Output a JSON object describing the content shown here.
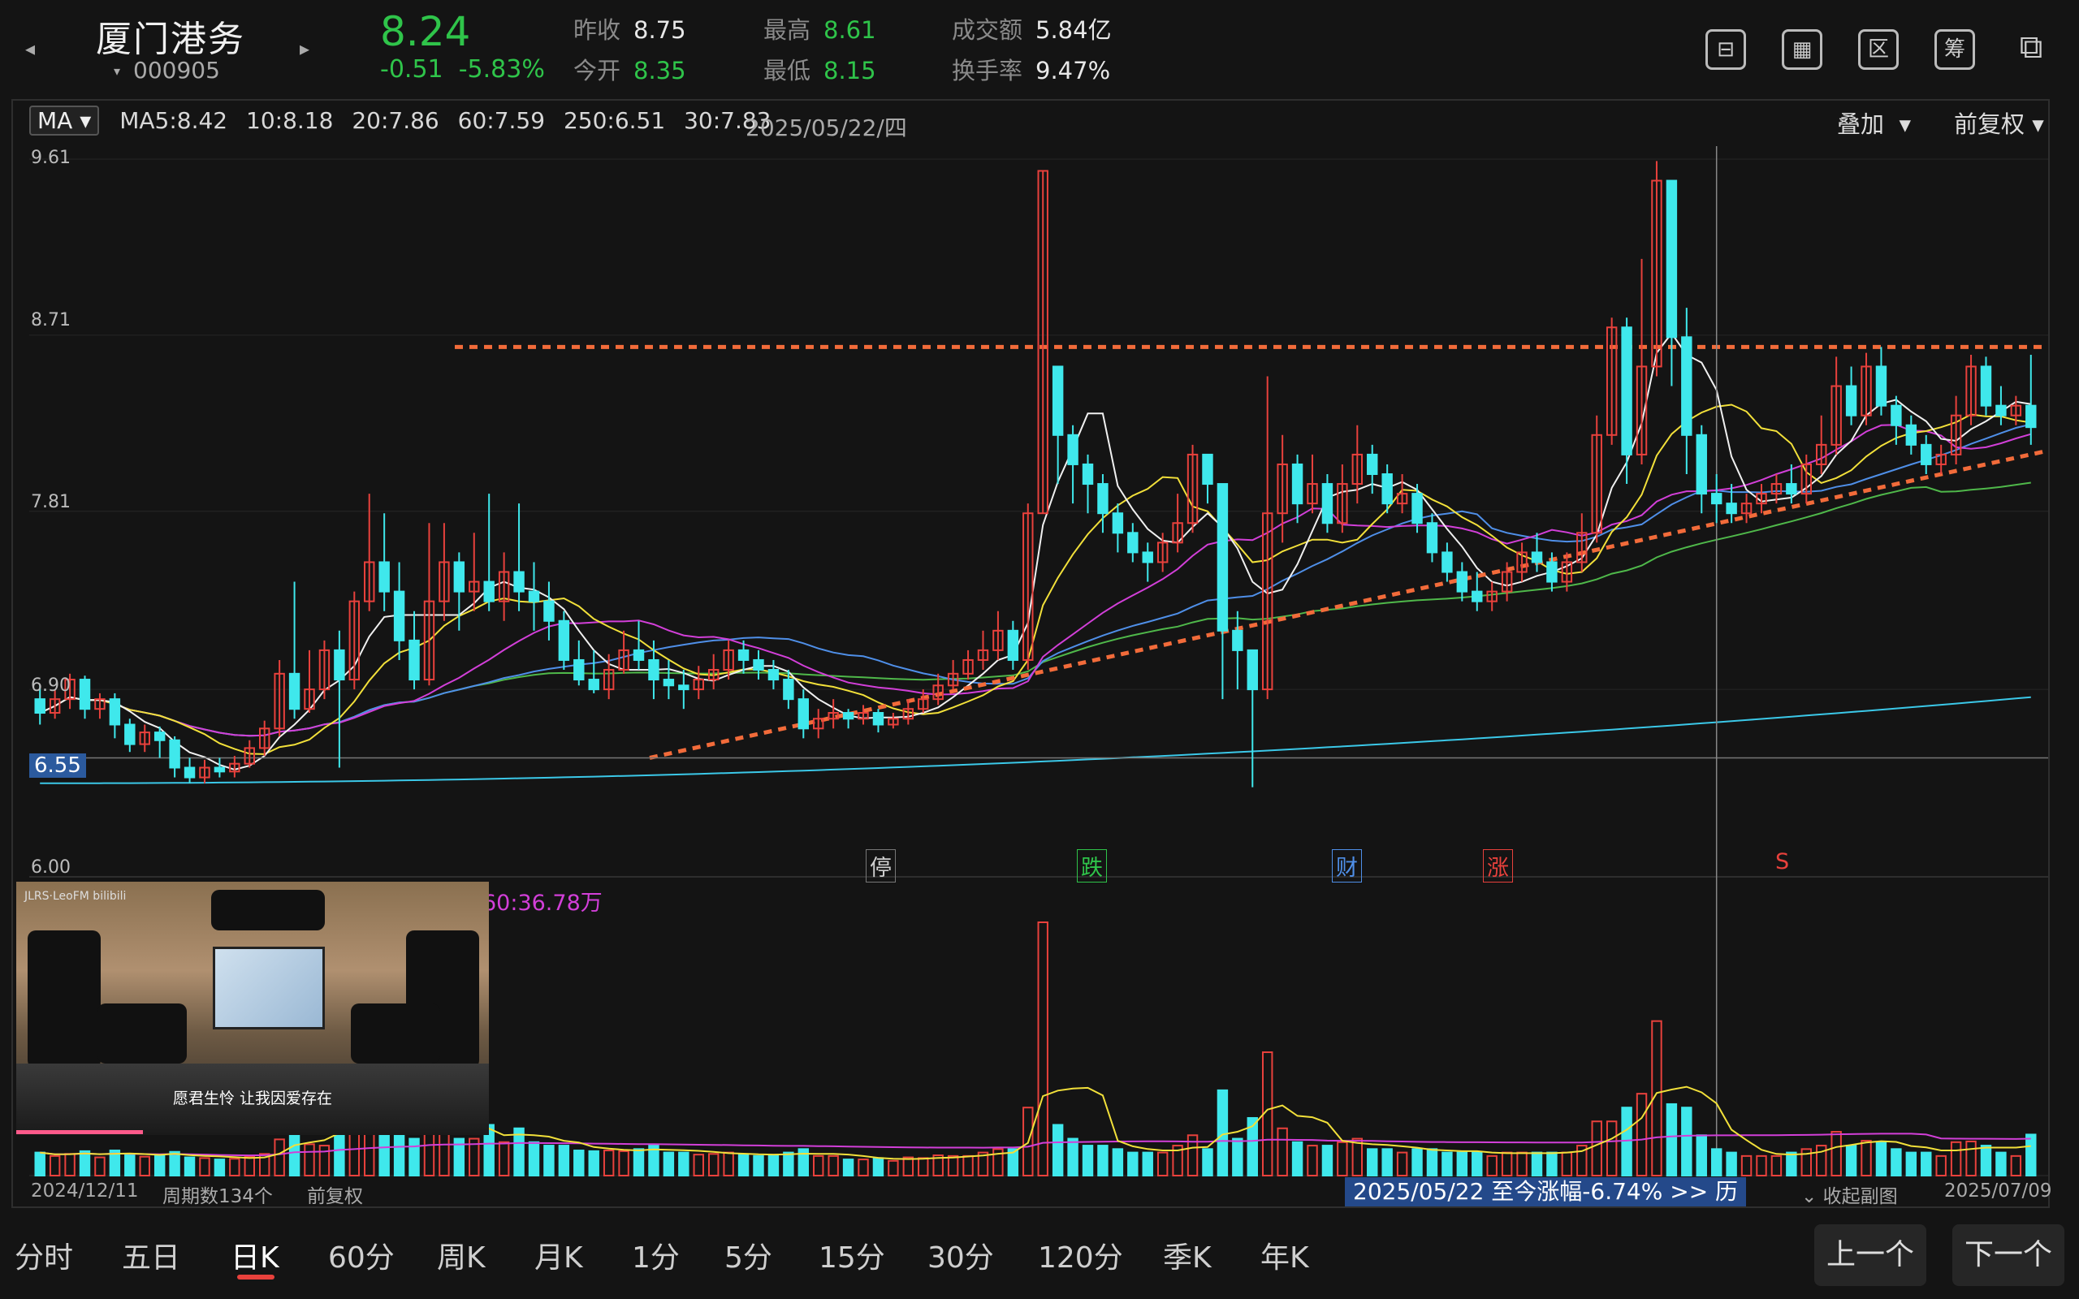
{
  "header": {
    "stock_name": "厦门港务",
    "stock_code": "000905",
    "price": "8.24",
    "change": "-0.51",
    "change_pct": "-5.83%",
    "stats": [
      {
        "label": "昨收",
        "value": "8.75",
        "color": "w"
      },
      {
        "label": "今开",
        "value": "8.35",
        "color": "g"
      },
      {
        "label": "最高",
        "value": "8.61",
        "color": "g"
      },
      {
        "label": "最低",
        "value": "8.15",
        "color": "g"
      },
      {
        "label": "成交额",
        "value": "5.84亿",
        "color": "w"
      },
      {
        "label": "换手率",
        "value": "9.47%",
        "color": "w"
      }
    ],
    "tools": [
      "⊟",
      "▦",
      "区",
      "筹",
      "⧉"
    ]
  },
  "ma_bar": {
    "button": "MA",
    "items": [
      {
        "text": "MA5:8.42",
        "color": "#f0f0f0"
      },
      {
        "text": "10:8.18",
        "color": "#f2e03a"
      },
      {
        "text": "20:7.86",
        "color": "#d23fd8"
      },
      {
        "text": "60:7.59",
        "color": "#4fb84a"
      },
      {
        "text": "250:6.51",
        "color": "#3bc8e8"
      },
      {
        "text": "30:7.83",
        "color": "#4f8fe8"
      }
    ],
    "date": "2025/05/22/四",
    "overlay": "叠加",
    "adjust": "前复权"
  },
  "y_axis": [
    "9.61",
    "8.71",
    "7.81",
    "6.90",
    "6.00"
  ],
  "price_tag": "6.55",
  "markers": [
    {
      "text": "停",
      "color": "#cfcfcf",
      "border": "#777"
    },
    {
      "text": "跌",
      "color": "#2fc44a",
      "border": "#2fc44a"
    },
    {
      "text": "财",
      "color": "#4f8fe8",
      "border": "#4f8fe8"
    },
    {
      "text": "涨",
      "color": "#e8413c",
      "border": "#e8413c"
    },
    {
      "text": "S",
      "color": "#e8413c",
      "border": "transparent"
    }
  ],
  "volume": {
    "ma_label": "60:36.78万"
  },
  "bottom": {
    "start_date": "2024/12/11",
    "period_count": "周期数134个",
    "adjust": "前复权",
    "range_info": "2025/05/22 至今涨幅-6.74%  >> 历",
    "collapse": "收起副图",
    "end_date": "2025/07/09"
  },
  "video": {
    "brand": "JLRS·LeoFM bilibili",
    "caption": "愿君生怜 让我因爱存在"
  },
  "tabs": [
    "分时",
    "五日",
    "日K",
    "60分",
    "周K",
    "月K",
    "1分",
    "5分",
    "15分",
    "30分",
    "120分",
    "季K",
    "年K"
  ],
  "active_tab": "日K",
  "nav": {
    "prev": "上一个",
    "next": "下一个"
  },
  "colors": {
    "up": "#e8413c",
    "down": "#3fe8ec",
    "ma5": "#f0f0f0",
    "ma10": "#f2e03a",
    "ma20": "#d23fd8",
    "ma60": "#4fb84a",
    "ma250": "#3bc8e8",
    "ma30": "#4f8fe8",
    "trendline": "#f26b3a"
  },
  "chart_data": {
    "type": "candlestick",
    "ylim": [
      6.0,
      9.61
    ],
    "date_range": [
      "2024/12/11",
      "2025/07/09"
    ],
    "periods": 134,
    "candles": [
      [
        6.85,
        6.78,
        6.92,
        6.72
      ],
      [
        6.78,
        6.85,
        6.9,
        6.75
      ],
      [
        6.85,
        6.95,
        6.98,
        6.8
      ],
      [
        6.95,
        6.8,
        6.97,
        6.75
      ],
      [
        6.8,
        6.85,
        6.88,
        6.75
      ],
      [
        6.85,
        6.72,
        6.88,
        6.65
      ],
      [
        6.72,
        6.62,
        6.75,
        6.58
      ],
      [
        6.62,
        6.68,
        6.72,
        6.58
      ],
      [
        6.68,
        6.64,
        6.71,
        6.55
      ],
      [
        6.64,
        6.5,
        6.66,
        6.45
      ],
      [
        6.5,
        6.45,
        6.55,
        6.42
      ],
      [
        6.45,
        6.5,
        6.54,
        6.42
      ],
      [
        6.5,
        6.48,
        6.55,
        6.45
      ],
      [
        6.48,
        6.52,
        6.56,
        6.45
      ],
      [
        6.52,
        6.6,
        6.64,
        6.5
      ],
      [
        6.6,
        6.7,
        6.74,
        6.56
      ],
      [
        6.7,
        6.98,
        7.05,
        6.66
      ],
      [
        6.98,
        6.8,
        7.45,
        6.75
      ],
      [
        6.8,
        6.9,
        7.1,
        6.78
      ],
      [
        6.9,
        7.1,
        7.15,
        6.85
      ],
      [
        7.1,
        6.95,
        7.2,
        6.5
      ],
      [
        6.95,
        7.35,
        7.4,
        6.9
      ],
      [
        7.35,
        7.55,
        7.9,
        7.3
      ],
      [
        7.55,
        7.4,
        7.8,
        7.3
      ],
      [
        7.4,
        7.15,
        7.55,
        7.05
      ],
      [
        7.15,
        6.95,
        7.3,
        6.9
      ],
      [
        6.95,
        7.35,
        7.75,
        6.92
      ],
      [
        7.35,
        7.55,
        7.75,
        7.25
      ],
      [
        7.55,
        7.4,
        7.6,
        7.2
      ],
      [
        7.4,
        7.45,
        7.7,
        7.3
      ],
      [
        7.45,
        7.35,
        7.9,
        7.3
      ],
      [
        7.35,
        7.5,
        7.6,
        7.25
      ],
      [
        7.5,
        7.4,
        7.85,
        7.3
      ],
      [
        7.4,
        7.35,
        7.55,
        7.2
      ],
      [
        7.35,
        7.25,
        7.45,
        7.15
      ],
      [
        7.25,
        7.05,
        7.3,
        7.0
      ],
      [
        7.05,
        6.95,
        7.15,
        6.92
      ],
      [
        6.95,
        6.9,
        7.1,
        6.88
      ],
      [
        6.9,
        7.0,
        7.08,
        6.85
      ],
      [
        7.0,
        7.1,
        7.2,
        6.98
      ],
      [
        7.1,
        7.05,
        7.25,
        7.0
      ],
      [
        7.05,
        6.95,
        7.15,
        6.85
      ],
      [
        6.95,
        6.92,
        7.05,
        6.85
      ],
      [
        6.92,
        6.9,
        7.0,
        6.8
      ],
      [
        6.9,
        6.95,
        7.02,
        6.85
      ],
      [
        6.95,
        7.0,
        7.08,
        6.9
      ],
      [
        7.0,
        7.1,
        7.15,
        6.95
      ],
      [
        7.1,
        7.05,
        7.15,
        6.98
      ],
      [
        7.05,
        7.0,
        7.1,
        6.95
      ],
      [
        7.0,
        6.95,
        7.05,
        6.9
      ],
      [
        6.95,
        6.85,
        7.0,
        6.8
      ],
      [
        6.85,
        6.7,
        6.9,
        6.65
      ],
      [
        6.7,
        6.75,
        6.8,
        6.65
      ],
      [
        6.75,
        6.78,
        6.85,
        6.7
      ],
      [
        6.78,
        6.75,
        6.8,
        6.7
      ],
      [
        6.75,
        6.78,
        6.82,
        6.72
      ],
      [
        6.78,
        6.72,
        6.8,
        6.68
      ],
      [
        6.72,
        6.75,
        6.78,
        6.7
      ],
      [
        6.75,
        6.8,
        6.85,
        6.72
      ],
      [
        6.8,
        6.85,
        6.9,
        6.78
      ],
      [
        6.85,
        6.92,
        6.98,
        6.82
      ],
      [
        6.92,
        6.98,
        7.05,
        6.9
      ],
      [
        6.98,
        7.05,
        7.1,
        6.95
      ],
      [
        7.05,
        7.1,
        7.2,
        7.0
      ],
      [
        7.1,
        7.2,
        7.3,
        7.05
      ],
      [
        7.2,
        7.05,
        7.25,
        7.0
      ],
      [
        7.05,
        7.8,
        7.85,
        7.0
      ],
      [
        7.8,
        9.55,
        9.55,
        7.8
      ],
      [
        8.55,
        8.2,
        8.55,
        7.95
      ],
      [
        8.2,
        8.05,
        8.25,
        7.85
      ],
      [
        8.05,
        7.95,
        8.1,
        7.8
      ],
      [
        7.95,
        7.8,
        8.0,
        7.7
      ],
      [
        7.8,
        7.7,
        7.85,
        7.6
      ],
      [
        7.7,
        7.6,
        7.75,
        7.55
      ],
      [
        7.6,
        7.55,
        7.65,
        7.45
      ],
      [
        7.55,
        7.65,
        7.7,
        7.5
      ],
      [
        7.65,
        7.75,
        7.9,
        7.6
      ],
      [
        7.75,
        8.1,
        8.15,
        7.7
      ],
      [
        8.1,
        7.95,
        8.1,
        7.85
      ],
      [
        7.95,
        7.2,
        7.95,
        6.85
      ],
      [
        7.2,
        7.1,
        7.3,
        6.9
      ],
      [
        7.1,
        6.9,
        7.1,
        6.4
      ],
      [
        6.9,
        7.8,
        8.5,
        6.85
      ],
      [
        7.8,
        8.05,
        8.2,
        7.65
      ],
      [
        8.05,
        7.85,
        8.1,
        7.75
      ],
      [
        7.85,
        7.95,
        8.1,
        7.8
      ],
      [
        7.95,
        7.75,
        8.0,
        7.7
      ],
      [
        7.75,
        7.95,
        8.05,
        7.7
      ],
      [
        7.95,
        8.1,
        8.25,
        7.85
      ],
      [
        8.1,
        8.0,
        8.15,
        7.9
      ],
      [
        8.0,
        7.85,
        8.05,
        7.8
      ],
      [
        7.85,
        7.9,
        8.0,
        7.8
      ],
      [
        7.9,
        7.75,
        7.95,
        7.7
      ],
      [
        7.75,
        7.6,
        7.8,
        7.55
      ],
      [
        7.6,
        7.5,
        7.65,
        7.45
      ],
      [
        7.5,
        7.4,
        7.55,
        7.35
      ],
      [
        7.4,
        7.35,
        7.5,
        7.3
      ],
      [
        7.35,
        7.4,
        7.45,
        7.3
      ],
      [
        7.4,
        7.5,
        7.55,
        7.35
      ],
      [
        7.5,
        7.6,
        7.65,
        7.45
      ],
      [
        7.6,
        7.55,
        7.7,
        7.5
      ],
      [
        7.55,
        7.45,
        7.6,
        7.4
      ],
      [
        7.45,
        7.55,
        7.6,
        7.4
      ],
      [
        7.55,
        7.7,
        7.8,
        7.5
      ],
      [
        7.7,
        8.2,
        8.3,
        7.65
      ],
      [
        8.2,
        8.75,
        8.8,
        8.15
      ],
      [
        8.75,
        8.1,
        8.8,
        7.95
      ],
      [
        8.1,
        8.55,
        9.1,
        8.05
      ],
      [
        8.55,
        9.5,
        9.6,
        8.5
      ],
      [
        9.5,
        8.7,
        9.35,
        8.45
      ],
      [
        8.7,
        8.2,
        8.85,
        8.0
      ],
      [
        8.2,
        7.9,
        8.25,
        7.8
      ],
      [
        7.9,
        7.85,
        8.0,
        7.75
      ],
      [
        7.85,
        7.8,
        7.95,
        7.75
      ],
      [
        7.8,
        7.85,
        7.9,
        7.75
      ],
      [
        7.85,
        7.9,
        7.95,
        7.8
      ],
      [
        7.9,
        7.95,
        8.0,
        7.85
      ],
      [
        7.95,
        7.9,
        8.05,
        7.85
      ],
      [
        7.9,
        8.05,
        8.1,
        7.85
      ],
      [
        8.05,
        8.15,
        8.3,
        8.0
      ],
      [
        8.15,
        8.45,
        8.6,
        8.1
      ],
      [
        8.45,
        8.3,
        8.55,
        8.25
      ],
      [
        8.3,
        8.55,
        8.62,
        8.25
      ],
      [
        8.55,
        8.35,
        8.65,
        8.3
      ],
      [
        8.35,
        8.25,
        8.4,
        8.15
      ],
      [
        8.25,
        8.15,
        8.3,
        8.1
      ],
      [
        8.15,
        8.05,
        8.2,
        8.0
      ],
      [
        8.05,
        8.1,
        8.15,
        8.0
      ],
      [
        8.1,
        8.3,
        8.4,
        8.05
      ],
      [
        8.3,
        8.55,
        8.61,
        8.25
      ],
      [
        8.55,
        8.35,
        8.6,
        8.3
      ],
      [
        8.35,
        8.3,
        8.45,
        8.25
      ],
      [
        8.3,
        8.35,
        8.4,
        8.25
      ],
      [
        8.35,
        8.24,
        8.61,
        8.15
      ]
    ],
    "support_line": {
      "from": [
        6.55,
        6.64
      ],
      "to": [
        8.12,
        8.2
      ]
    },
    "resistance_level": 8.65,
    "reference_level": 6.55
  }
}
